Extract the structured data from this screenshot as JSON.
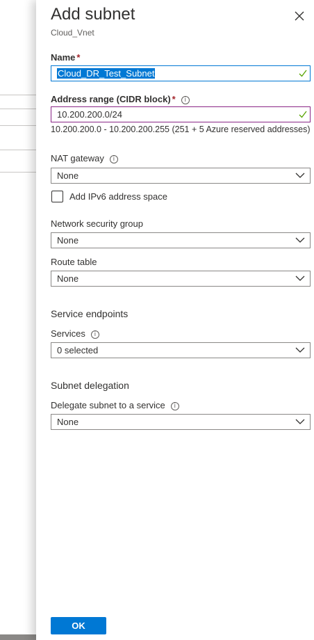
{
  "panel": {
    "title": "Add subnet",
    "subtitle": "Cloud_Vnet"
  },
  "name_field": {
    "label": "Name",
    "required_mark": "*",
    "value": "Cloud_DR_Test_Subnet"
  },
  "address_range": {
    "label": "Address range (CIDR block)",
    "required_mark": "*",
    "value": "10.200.200.0/24",
    "hint": "10.200.200.0 - 10.200.200.255 (251 + 5 Azure reserved addresses)"
  },
  "nat_gateway": {
    "label": "NAT gateway",
    "value": "None"
  },
  "ipv6_checkbox": {
    "label": "Add IPv6 address space",
    "checked": false
  },
  "network_security_group": {
    "label": "Network security group",
    "value": "None"
  },
  "route_table": {
    "label": "Route table",
    "value": "None"
  },
  "service_endpoints": {
    "heading": "Service endpoints",
    "services_label": "Services",
    "services_value": "0 selected"
  },
  "subnet_delegation": {
    "heading": "Subnet delegation",
    "delegate_label": "Delegate subnet to a service",
    "delegate_value": "None"
  },
  "footer": {
    "ok_label": "OK"
  },
  "icons": {
    "info": "info-icon",
    "close": "close-icon",
    "chevron": "chevron-down-icon",
    "valid": "checkmark-icon"
  },
  "colors": {
    "accent": "#0078d4",
    "required": "#a4262c",
    "valid": "#57a300"
  }
}
